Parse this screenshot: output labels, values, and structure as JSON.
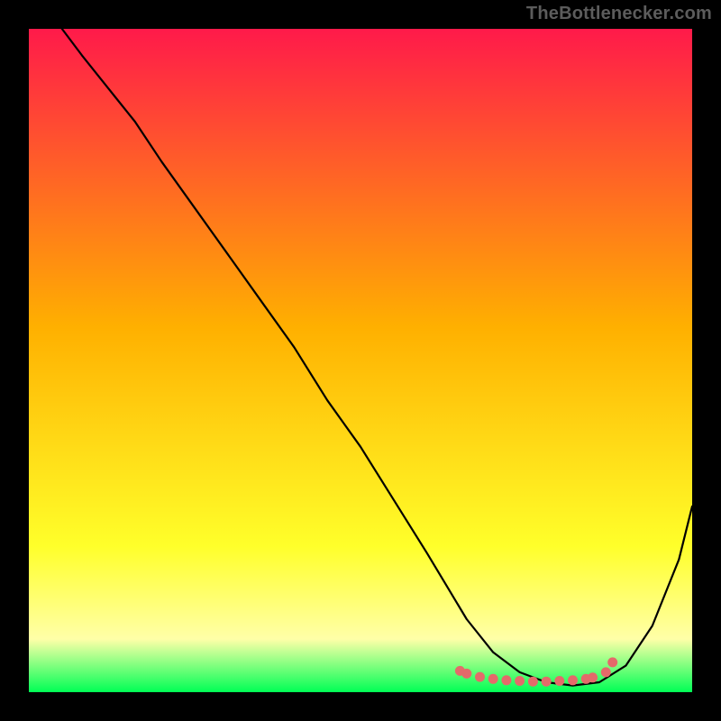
{
  "watermark": "TheBottlenecker.com",
  "colors": {
    "gradient_top": "#ff1a4a",
    "gradient_mid": "#ffb000",
    "gradient_yellow": "#ffff2a",
    "gradient_pale": "#ffffa8",
    "gradient_bottom": "#00ff55",
    "curve": "#000000",
    "marker": "#e46a6a"
  },
  "chart_data": {
    "type": "line",
    "title": "",
    "xlabel": "",
    "ylabel": "",
    "xlim": [
      0,
      100
    ],
    "ylim": [
      0,
      100
    ],
    "series": [
      {
        "name": "curve",
        "x": [
          5,
          8,
          12,
          16,
          20,
          25,
          30,
          35,
          40,
          45,
          50,
          55,
          60,
          63,
          66,
          70,
          74,
          78,
          82,
          86,
          90,
          94,
          98,
          100
        ],
        "y": [
          100,
          96,
          91,
          86,
          80,
          73,
          66,
          59,
          52,
          44,
          37,
          29,
          21,
          16,
          11,
          6,
          3,
          1.5,
          1,
          1.5,
          4,
          10,
          20,
          28
        ]
      },
      {
        "name": "markers-dense",
        "x": [
          65,
          66,
          68,
          70,
          72,
          74,
          76,
          78,
          80,
          82,
          84,
          85,
          87,
          88
        ],
        "y": [
          3.2,
          2.8,
          2.3,
          2.0,
          1.8,
          1.7,
          1.6,
          1.6,
          1.7,
          1.8,
          2.0,
          2.2,
          3.0,
          4.5
        ]
      }
    ]
  }
}
